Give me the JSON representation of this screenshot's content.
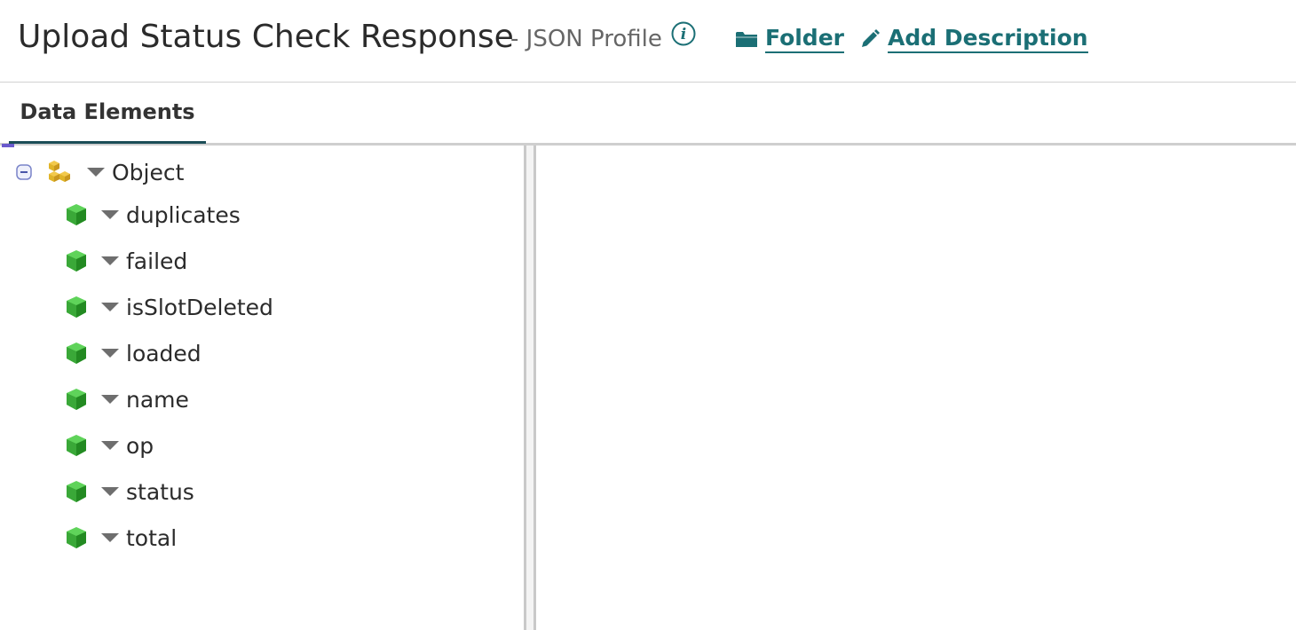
{
  "header": {
    "title": "Upload Status Check Response",
    "subtitle": "- JSON Profile",
    "folder_link": "Folder",
    "description_link": "Add Description"
  },
  "tabs": [
    {
      "label": "Data Elements",
      "active": true
    }
  ],
  "tree": {
    "root": {
      "label": "Object",
      "icon": "object-icon",
      "expanded": true
    },
    "children": [
      {
        "label": "duplicates",
        "icon": "element-icon"
      },
      {
        "label": "failed",
        "icon": "element-icon"
      },
      {
        "label": "isSlotDeleted",
        "icon": "element-icon"
      },
      {
        "label": "loaded",
        "icon": "element-icon"
      },
      {
        "label": "name",
        "icon": "element-icon"
      },
      {
        "label": "op",
        "icon": "element-icon"
      },
      {
        "label": "status",
        "icon": "element-icon"
      },
      {
        "label": "total",
        "icon": "element-icon"
      }
    ]
  },
  "colors": {
    "link": "#1b6f75",
    "tab_underline": "#1b4d57",
    "element_icon": "#3aa838",
    "object_icon": "#e0b429"
  }
}
